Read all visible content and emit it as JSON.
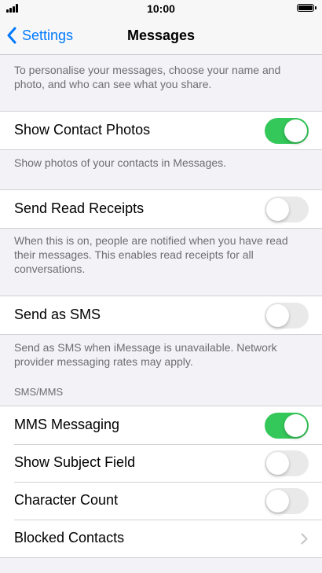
{
  "status_bar": {
    "time": "10:00"
  },
  "nav": {
    "back_label": "Settings",
    "title": "Messages"
  },
  "intro_text": "To personalise your messages, choose your name and photo, and who can see what you share.",
  "settings": {
    "show_contact_photos": {
      "label": "Show Contact Photos",
      "enabled": true,
      "footer": "Show photos of your contacts in Messages."
    },
    "send_read_receipts": {
      "label": "Send Read Receipts",
      "enabled": false,
      "footer": "When this is on, people are notified when you have read their messages. This enables read receipts for all conversations."
    },
    "send_as_sms": {
      "label": "Send as SMS",
      "enabled": false,
      "footer": "Send as SMS when iMessage is unavailable. Network provider messaging rates may apply."
    }
  },
  "sms_mms": {
    "header": "SMS/MMS",
    "mms_messaging": {
      "label": "MMS Messaging",
      "enabled": true
    },
    "show_subject_field": {
      "label": "Show Subject Field",
      "enabled": false
    },
    "character_count": {
      "label": "Character Count",
      "enabled": false
    },
    "blocked_contacts": {
      "label": "Blocked Contacts"
    }
  },
  "colors": {
    "accent": "#007aff",
    "toggle_on": "#34c759",
    "toggle_off": "#e9e9ea",
    "background": "#f2f2f7"
  },
  "icons": {
    "back": "chevron-left-icon",
    "disclosure": "chevron-right-icon"
  }
}
